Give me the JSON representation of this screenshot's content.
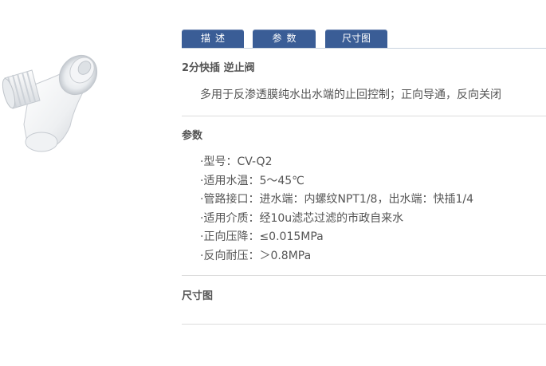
{
  "tabs": [
    {
      "label": "描述"
    },
    {
      "label": "参数"
    },
    {
      "label": "尺寸图"
    }
  ],
  "description": {
    "title": "2分快插  逆止阀",
    "text": "多用于反渗透膜纯水出水端的止回控制；正向导通，反向关闭"
  },
  "parameters": {
    "title": "参数",
    "items": [
      "·型号：CV-Q2",
      "·适用水温：5～45℃",
      "·管路接口：进水端：内螺纹NPT1/8，出水端：快插1/4",
      "·适用介质：经10u滤芯过滤的市政自来水",
      "·正向压降：≤0.015MPa",
      "·反向耐压：＞0.8MPa"
    ]
  },
  "size_drawing": {
    "title": "尺寸图"
  },
  "colors": {
    "tab_bg": "#3a5d96",
    "text": "#555555",
    "divider": "#dddddd"
  }
}
